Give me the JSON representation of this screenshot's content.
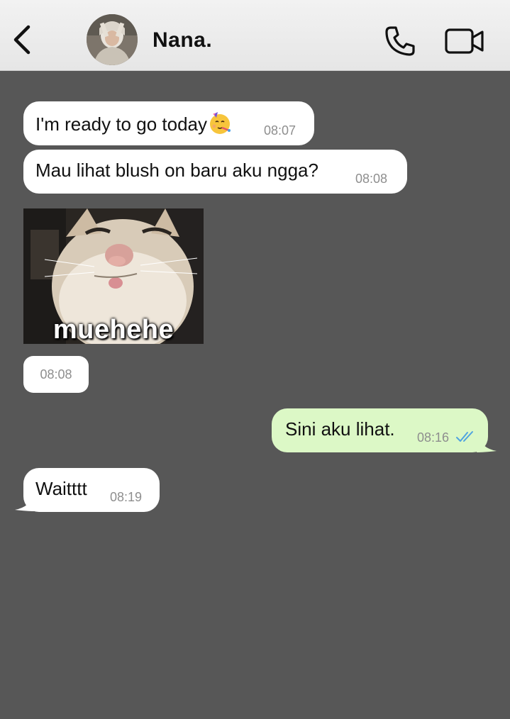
{
  "header": {
    "back_icon": "chevron-left-icon",
    "contact_name": "Nana.",
    "call_icon": "phone-icon",
    "video_icon": "video-camera-icon"
  },
  "messages": [
    {
      "direction": "incoming",
      "text": "I'm ready to go today",
      "emoji": "partying-face",
      "time": "08:07"
    },
    {
      "direction": "incoming",
      "text": "Mau lihat blush on baru aku ngga?",
      "time": "08:08"
    },
    {
      "direction": "incoming",
      "type": "sticker",
      "caption": "muehehe",
      "time": "08:08"
    },
    {
      "direction": "outgoing",
      "text": "Sini aku lihat.",
      "time": "08:16",
      "status": "read"
    },
    {
      "direction": "incoming",
      "text": "Waitttt",
      "time": "08:19"
    }
  ],
  "colors": {
    "chat_background": "#575757",
    "incoming_bubble": "#ffffff",
    "outgoing_bubble": "#dcf8c6",
    "read_ticks": "#4fa3e0",
    "header_background": "#eeeeee"
  }
}
